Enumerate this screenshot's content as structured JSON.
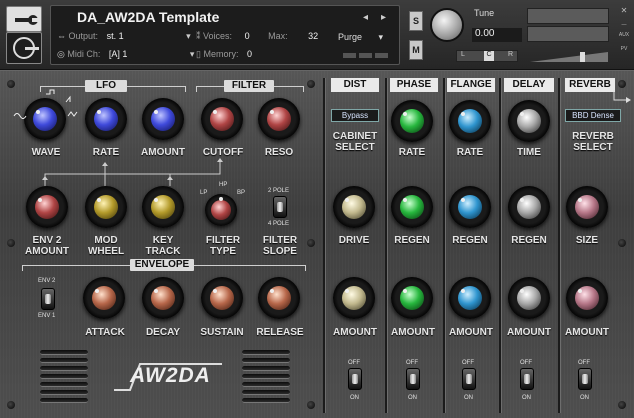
{
  "header": {
    "title": "DA_AW2DA Template",
    "output_label": "Output:",
    "output_value": "st. 1",
    "midi_label": "Midi Ch:",
    "midi_value": "[A] 1",
    "voices_label": "Voices:",
    "voices_value": "0",
    "max_label": "Max:",
    "max_value": "32",
    "memory_label": "Memory:",
    "memory_value": "0",
    "purge_label": "Purge",
    "s_label": "S",
    "m_label": "M",
    "tune_label": "Tune",
    "tune_value": "0.00",
    "aux_label": "AUX",
    "pv_label": "PV",
    "pan_left": "L",
    "pan_right": "R",
    "pan_center": "C"
  },
  "sections": {
    "lfo": "LFO",
    "filter": "FILTER",
    "envelope": "ENVELOPE",
    "dist": "DIST",
    "phase": "PHASE",
    "flange": "FLANGE",
    "delay": "DELAY",
    "reverb": "REVERB"
  },
  "knobs": {
    "wave": "WAVE",
    "rate": "RATE",
    "amount": "AMOUNT",
    "cutoff": "CUTOFF",
    "reso": "RESO",
    "env2_amount": "ENV 2\nAMOUNT",
    "mod_wheel": "MOD\nWHEEL",
    "key_track": "KEY\nTRACK",
    "filter_type": "FILTER\nTYPE",
    "filter_slope": "FILTER\nSLOPE",
    "attack": "ATTACK",
    "decay": "DECAY",
    "sustain": "SUSTAIN",
    "release": "RELEASE"
  },
  "filter_type_options": {
    "lp": "LP",
    "hp": "HP",
    "bp": "BP"
  },
  "filter_slope_options": {
    "two": "2 POLE",
    "four": "4 POLE"
  },
  "env_switch": {
    "env2": "ENV 2",
    "env1": "ENV 1"
  },
  "fx": {
    "dist_select": "Bypass",
    "dist_select_label": "CABINET\nSELECT",
    "reverb_select": "BBD Dense",
    "reverb_select_label": "REVERB\nSELECT",
    "phase_rate": "RATE",
    "flange_rate": "RATE",
    "delay_time": "TIME",
    "dist_drive": "DRIVE",
    "phase_regen": "REGEN",
    "flange_regen": "REGEN",
    "delay_regen": "REGEN",
    "reverb_size": "SIZE",
    "amount": "AMOUNT",
    "off": "OFF",
    "on": "ON"
  },
  "brand": "AW2DA"
}
